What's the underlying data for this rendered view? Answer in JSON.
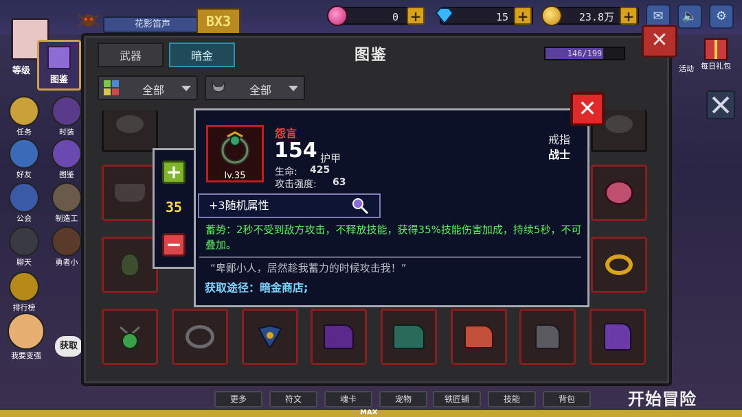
{
  "hud": {
    "player_name": "花影笛声",
    "level_badge": "BX3",
    "gems": "0",
    "diamonds": "15",
    "gold": "23.8万",
    "plus": "+"
  },
  "left_menu": {
    "level_label": "等级",
    "codex_label": "图鉴",
    "items": [
      {
        "label": "任务"
      },
      {
        "label": "时装"
      },
      {
        "label": "好友"
      },
      {
        "label": "图鉴"
      },
      {
        "label": "公会"
      },
      {
        "label": "制造工"
      },
      {
        "label": "聊天"
      },
      {
        "label": "勇者小"
      },
      {
        "label": "排行榜"
      },
      {
        "label": "我要变强"
      },
      {
        "label": "获取"
      }
    ]
  },
  "right_menu": {
    "activity_label": "活动",
    "daily_gift_label": "每日礼包"
  },
  "panel": {
    "title": "图鉴",
    "tabs": [
      "武器",
      "暗金"
    ],
    "progress_text": "146/199",
    "progress_fraction": 0.734,
    "filters": [
      {
        "label": "全部"
      },
      {
        "label": "全部"
      }
    ],
    "close": "✕"
  },
  "stepper": {
    "plus": "+",
    "minus": "−",
    "value": "35"
  },
  "tooltip": {
    "name": "怨言",
    "level": "lv.35",
    "main_value": "154",
    "main_stat": "护甲",
    "stat_hp_label": "生命:",
    "stat_hp_value": "425",
    "stat_atk_label": "攻击强度:",
    "stat_atk_value": "63",
    "type": "戒指",
    "class": "战士",
    "random_attr": "+3随机属性",
    "effect": "蓄势：2秒不受到敌方攻击，不释放技能，获得35%技能伤害加成，持续5秒，不可叠加。",
    "quote": "“卑鄙小人，居然趁我蓄力的时候攻击我！”",
    "source": "获取途径：暗金商店;",
    "close": "✕"
  },
  "bottom_bar": {
    "buttons": [
      "更多",
      "符文",
      "魂卡",
      "宠物",
      "铁匠铺",
      "技能",
      "背包"
    ],
    "start": "开始冒险",
    "max": "MAX"
  },
  "colors": {
    "rarity_red": "#c01f1f",
    "effect_green": "#5df05d",
    "source_blue": "#7fd7ff",
    "tab_active": "#2d8fb1"
  }
}
